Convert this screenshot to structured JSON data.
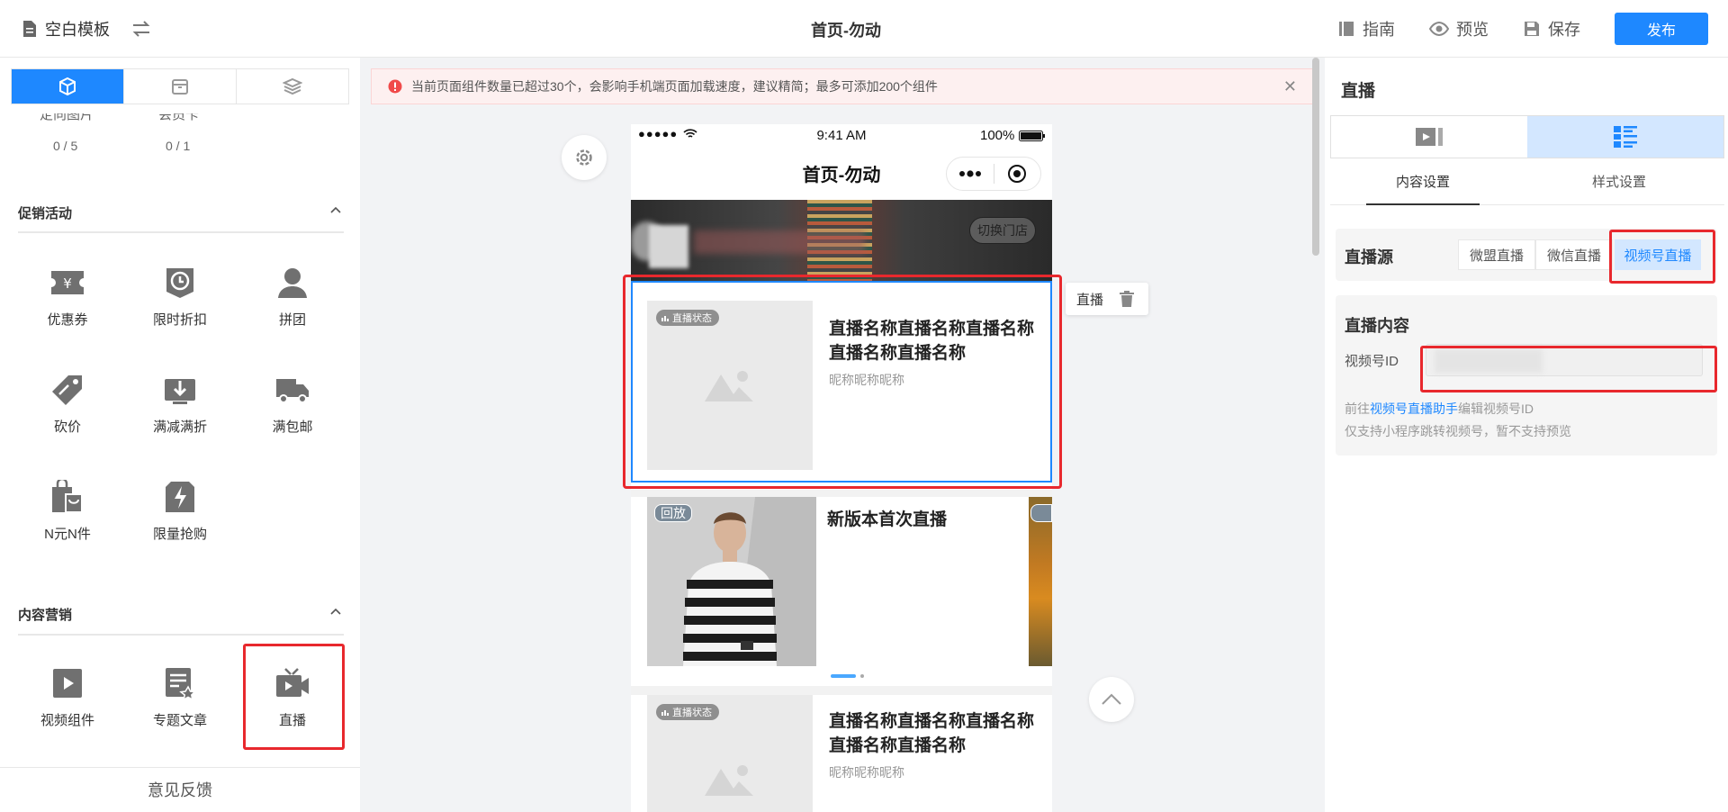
{
  "header": {
    "template_label": "空白模板",
    "page_title": "首页-勿动",
    "guide_label": "指南",
    "preview_label": "预览",
    "save_label": "保存",
    "publish_label": "发布"
  },
  "left_panel": {
    "partial_labels": [
      "定向图片",
      "会员卡"
    ],
    "partial_counts": [
      "0 / 5",
      "0 / 1"
    ],
    "promo_section": {
      "title": "促销活动",
      "items": [
        "优惠券",
        "限时折扣",
        "拼团",
        "砍价",
        "满减满折",
        "满包邮",
        "N元N件",
        "限量抢购"
      ]
    },
    "content_section": {
      "title": "内容营销",
      "items": [
        "视频组件",
        "专题文章",
        "直播"
      ]
    },
    "feedback_label": "意见反馈"
  },
  "canvas": {
    "alert_text": "当前页面组件数量已超过30个，会影响手机端页面加载速度，建议精简；最多可添加200个组件",
    "phone": {
      "time": "9:41 AM",
      "battery": "100%",
      "nav_title": "首页-勿动",
      "switch_store_label": "切换门店",
      "live_card": {
        "badge": "直播状态",
        "name": "直播名称直播名称直播名称直播名称直播名称",
        "nickname": "昵称昵称昵称"
      },
      "carousel": {
        "replay_badge": "回放",
        "title": "新版本首次直播"
      },
      "live_card_2": {
        "badge": "直播状态",
        "name": "直播名称直播名称直播名称直播名称直播名称",
        "nickname": "昵称昵称昵称"
      }
    },
    "float_toolbar_label": "直播"
  },
  "right_panel": {
    "title": "直播",
    "settings_tabs": [
      "内容设置",
      "样式设置"
    ],
    "source_label": "直播源",
    "source_options": [
      "微盟直播",
      "微信直播",
      "视频号直播"
    ],
    "selected_source": "视频号直播",
    "content_label": "直播内容",
    "channel_id_label": "视频号ID",
    "channel_id_value": "",
    "hint_prefix": "前往",
    "hint_link": "视频号直播助手",
    "hint_suffix": "编辑视频号ID",
    "hint_line2": "仅支持小程序跳转视频号，暂不支持预览"
  },
  "colors": {
    "accent": "#1e88ff",
    "highlight_red": "#e8282d",
    "alert_bg": "#fdf0f0"
  }
}
